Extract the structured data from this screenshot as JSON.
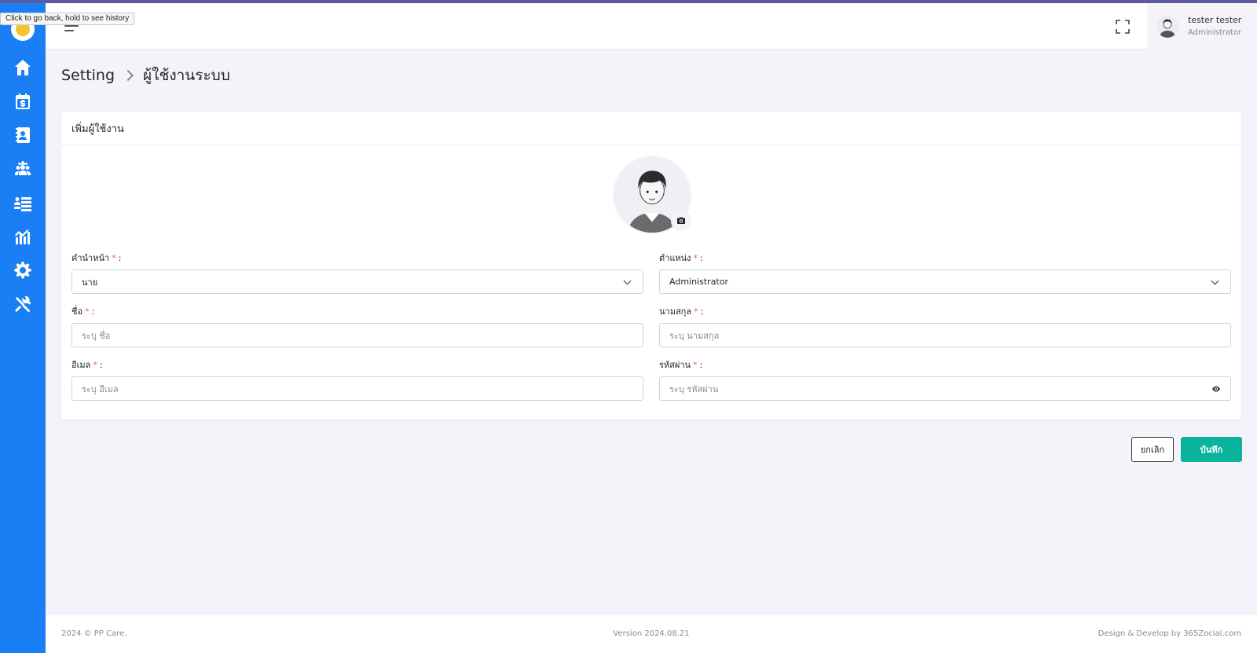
{
  "tooltip": "Click to go back, hold to see history",
  "header": {
    "user_name": "tester tester",
    "user_role": "Administrator"
  },
  "sidebar": {
    "items": [
      {
        "icon": "home-icon"
      },
      {
        "icon": "calendar-money-icon"
      },
      {
        "icon": "contacts-book-icon"
      },
      {
        "icon": "users-gear-icon"
      },
      {
        "icon": "list-users-icon"
      },
      {
        "icon": "chart-icon"
      },
      {
        "icon": "settings-gear-icon"
      },
      {
        "icon": "tools-icon"
      }
    ]
  },
  "breadcrumb": {
    "parent": "Setting",
    "current": "ผู้ใช้งานระบบ"
  },
  "card": {
    "title": "เพิ่มผู้ใช้งาน"
  },
  "form": {
    "prefix": {
      "label": "คำนำหน้า",
      "req": "*",
      "colon": ":",
      "value": "นาย"
    },
    "position": {
      "label": "ตำแหน่ง",
      "req": "*",
      "colon": ":",
      "value": "Administrator"
    },
    "first_name": {
      "label": "ชื่อ",
      "req": "*",
      "colon": ":",
      "placeholder": "ระบุ ชื่อ"
    },
    "last_name": {
      "label": "นามสกุล",
      "req": "*",
      "colon": ":",
      "placeholder": "ระบุ นามสกุล"
    },
    "email": {
      "label": "อีเมล",
      "req": "*",
      "colon": ":",
      "placeholder": "ระบุ อีเมล"
    },
    "password": {
      "label": "รหัสผ่าน",
      "req": "*",
      "colon": ":",
      "placeholder": "ระบุ รหัสผ่าน"
    }
  },
  "buttons": {
    "cancel": "ยกเลิก",
    "save": "บันทึก"
  },
  "footer": {
    "left": "2024 © PP Care.",
    "center": "Version 2024.08.21",
    "right": "Design & Develop by 365Zocial.com"
  },
  "colors": {
    "sidebar": "#1a7ff5",
    "primary_save": "#0ab39c",
    "required": "#f06548"
  }
}
